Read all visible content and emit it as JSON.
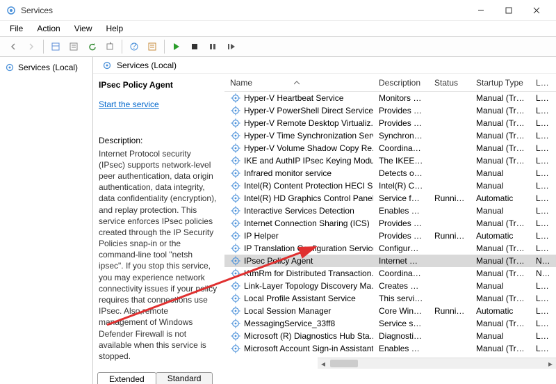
{
  "window": {
    "title": "Services"
  },
  "menu": {
    "file": "File",
    "action": "Action",
    "view": "View",
    "help": "Help"
  },
  "left_tree": {
    "root": "Services (Local)"
  },
  "right_header": "Services (Local)",
  "detail": {
    "selected_name": "IPsec Policy Agent",
    "start_link": "Start the service",
    "desc_label": "Description:",
    "description": "Internet Protocol security (IPsec) supports network-level peer authentication, data origin authentication, data integrity, data confidentiality (encryption), and replay protection.  This service enforces IPsec policies created through the IP Security Policies snap-in or the command-line tool \"netsh ipsec\".  If you stop this service, you may experience network connectivity issues if your policy requires that connections use IPsec.  Also,remote management of Windows Defender Firewall is not available when this service is stopped."
  },
  "columns": {
    "name": "Name",
    "description": "Description",
    "status": "Status",
    "startup": "Startup Type",
    "logon": "Log On As"
  },
  "tabs": {
    "extended": "Extended",
    "standard": "Standard"
  },
  "services": [
    {
      "name": "Hyper-V Heartbeat Service",
      "desc": "Monitors th...",
      "status": "",
      "startup": "Manual (Trig...",
      "logon": "Loc"
    },
    {
      "name": "Hyper-V PowerShell Direct Service",
      "desc": "Provides a ...",
      "status": "",
      "startup": "Manual (Trig...",
      "logon": "Loc"
    },
    {
      "name": "Hyper-V Remote Desktop Virtualiz...",
      "desc": "Provides a p...",
      "status": "",
      "startup": "Manual (Trig...",
      "logon": "Loc"
    },
    {
      "name": "Hyper-V Time Synchronization Serv...",
      "desc": "Synchronize...",
      "status": "",
      "startup": "Manual (Trig...",
      "logon": "Loc"
    },
    {
      "name": "Hyper-V Volume Shadow Copy Re...",
      "desc": "Coordinates...",
      "status": "",
      "startup": "Manual (Trig...",
      "logon": "Loc"
    },
    {
      "name": "IKE and AuthIP IPsec Keying Modu...",
      "desc": "The IKEEXT ...",
      "status": "",
      "startup": "Manual (Trig...",
      "logon": "Loc"
    },
    {
      "name": "Infrared monitor service",
      "desc": "Detects oth...",
      "status": "",
      "startup": "Manual",
      "logon": "Loc"
    },
    {
      "name": "Intel(R) Content Protection HECI S...",
      "desc": "Intel(R) Con...",
      "status": "",
      "startup": "Manual",
      "logon": "Loc"
    },
    {
      "name": "Intel(R) HD Graphics Control Panel...",
      "desc": "Service for I...",
      "status": "Running",
      "startup": "Automatic",
      "logon": "Loc"
    },
    {
      "name": "Interactive Services Detection",
      "desc": "Enables use...",
      "status": "",
      "startup": "Manual",
      "logon": "Loc"
    },
    {
      "name": "Internet Connection Sharing (ICS)",
      "desc": "Provides ne...",
      "status": "",
      "startup": "Manual (Trig...",
      "logon": "Loc"
    },
    {
      "name": "IP Helper",
      "desc": "Provides tu...",
      "status": "Running",
      "startup": "Automatic",
      "logon": "Loc"
    },
    {
      "name": "IP Translation Configuration Service",
      "desc": "Configures ...",
      "status": "",
      "startup": "Manual (Trig...",
      "logon": "Loc"
    },
    {
      "name": "IPsec Policy Agent",
      "desc": "Internet Pro...",
      "status": "",
      "startup": "Manual (Trig...",
      "logon": "Net",
      "selected": true
    },
    {
      "name": "KtmRm for Distributed Transaction...",
      "desc": "Coordinates...",
      "status": "",
      "startup": "Manual (Trig...",
      "logon": "Net"
    },
    {
      "name": "Link-Layer Topology Discovery Ma...",
      "desc": "Creates a N...",
      "status": "",
      "startup": "Manual",
      "logon": "Loc"
    },
    {
      "name": "Local Profile Assistant Service",
      "desc": "This service ...",
      "status": "",
      "startup": "Manual (Trig...",
      "logon": "Loc"
    },
    {
      "name": "Local Session Manager",
      "desc": "Core Windo...",
      "status": "Running",
      "startup": "Automatic",
      "logon": "Loc"
    },
    {
      "name": "MessagingService_33ff8",
      "desc": "Service sup...",
      "status": "",
      "startup": "Manual (Trig...",
      "logon": "Loc"
    },
    {
      "name": "Microsoft (R) Diagnostics Hub Sta...",
      "desc": "Diagnostics ...",
      "status": "",
      "startup": "Manual",
      "logon": "Loc"
    },
    {
      "name": "Microsoft Account Sign-in Assistant",
      "desc": "Enables use...",
      "status": "",
      "startup": "Manual (Trig...",
      "logon": "Loc"
    }
  ]
}
